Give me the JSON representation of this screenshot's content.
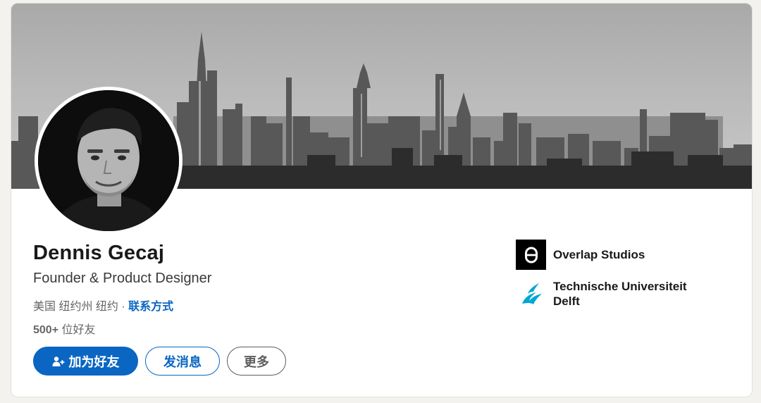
{
  "profile": {
    "name": "Dennis Gecaj",
    "headline": "Founder & Product Designer",
    "location": "美国 纽约州 纽约 · ",
    "contact_link": "联系方式",
    "friends_count": "500+",
    "friends_suffix": " 位好友"
  },
  "actions": {
    "add_friend": "加为好友",
    "message": "发消息",
    "more": "更多"
  },
  "organizations": [
    {
      "name": "Overlap Studios",
      "logo": "overlap-logo"
    },
    {
      "name": "Technische Universiteit Delft",
      "logo": "tu-delft-flame-logo"
    }
  ],
  "colors": {
    "accent": "#0a66c2",
    "tu_delft": "#00a6d6"
  }
}
